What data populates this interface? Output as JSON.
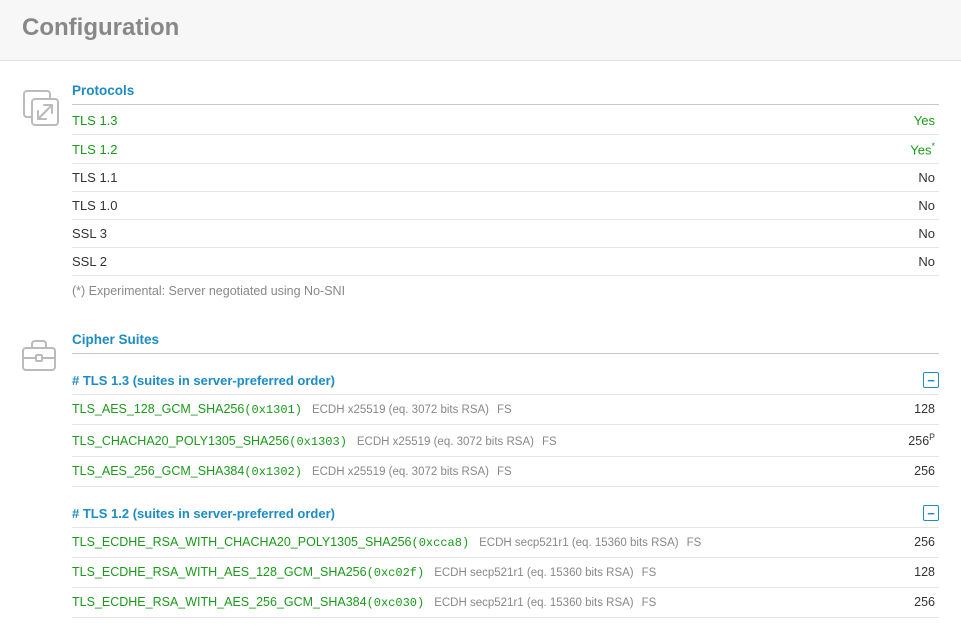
{
  "title": "Configuration",
  "sections": {
    "protocols": {
      "heading": "Protocols",
      "rows": [
        {
          "name": "TLS 1.3",
          "value": "Yes",
          "name_cls": "green",
          "val_cls": "green",
          "sup": ""
        },
        {
          "name": "TLS 1.2",
          "value": "Yes",
          "name_cls": "green",
          "val_cls": "green",
          "sup": "*"
        },
        {
          "name": "TLS 1.1",
          "value": "No",
          "name_cls": "dark",
          "val_cls": "dark",
          "sup": ""
        },
        {
          "name": "TLS 1.0",
          "value": "No",
          "name_cls": "dark",
          "val_cls": "dark",
          "sup": ""
        },
        {
          "name": "SSL 3",
          "value": "No",
          "name_cls": "dark",
          "val_cls": "dark",
          "sup": ""
        },
        {
          "name": "SSL 2",
          "value": "No",
          "name_cls": "dark",
          "val_cls": "dark",
          "sup": ""
        }
      ],
      "footnote": "(*) Experimental: Server negotiated using No-SNI"
    },
    "cipher_suites": {
      "heading": "Cipher Suites",
      "groups": [
        {
          "title": "# TLS 1.3 (suites in server-preferred order)",
          "rows": [
            {
              "name": "TLS_AES_128_GCM_SHA256",
              "code": "0x1301",
              "kx": "ECDH x25519 (eq. 3072 bits RSA)",
              "fs": "FS",
              "bits": "128",
              "sup": ""
            },
            {
              "name": "TLS_CHACHA20_POLY1305_SHA256",
              "code": "0x1303",
              "kx": "ECDH x25519 (eq. 3072 bits RSA)",
              "fs": "FS",
              "bits": "256",
              "sup": "P"
            },
            {
              "name": "TLS_AES_256_GCM_SHA384",
              "code": "0x1302",
              "kx": "ECDH x25519 (eq. 3072 bits RSA)",
              "fs": "FS",
              "bits": "256",
              "sup": ""
            }
          ]
        },
        {
          "title": "# TLS 1.2 (suites in server-preferred order)",
          "rows": [
            {
              "name": "TLS_ECDHE_RSA_WITH_CHACHA20_POLY1305_SHA256",
              "code": "0xcca8",
              "kx": "ECDH secp521r1 (eq. 15360 bits RSA)",
              "fs": "FS",
              "bits": "256",
              "sup": ""
            },
            {
              "name": "TLS_ECDHE_RSA_WITH_AES_128_GCM_SHA256",
              "code": "0xc02f",
              "kx": "ECDH secp521r1 (eq. 15360 bits RSA)",
              "fs": "FS",
              "bits": "128",
              "sup": ""
            },
            {
              "name": "TLS_ECDHE_RSA_WITH_AES_256_GCM_SHA384",
              "code": "0xc030",
              "kx": "ECDH secp521r1 (eq. 15360 bits RSA)",
              "fs": "FS",
              "bits": "256",
              "sup": ""
            }
          ]
        }
      ]
    }
  }
}
